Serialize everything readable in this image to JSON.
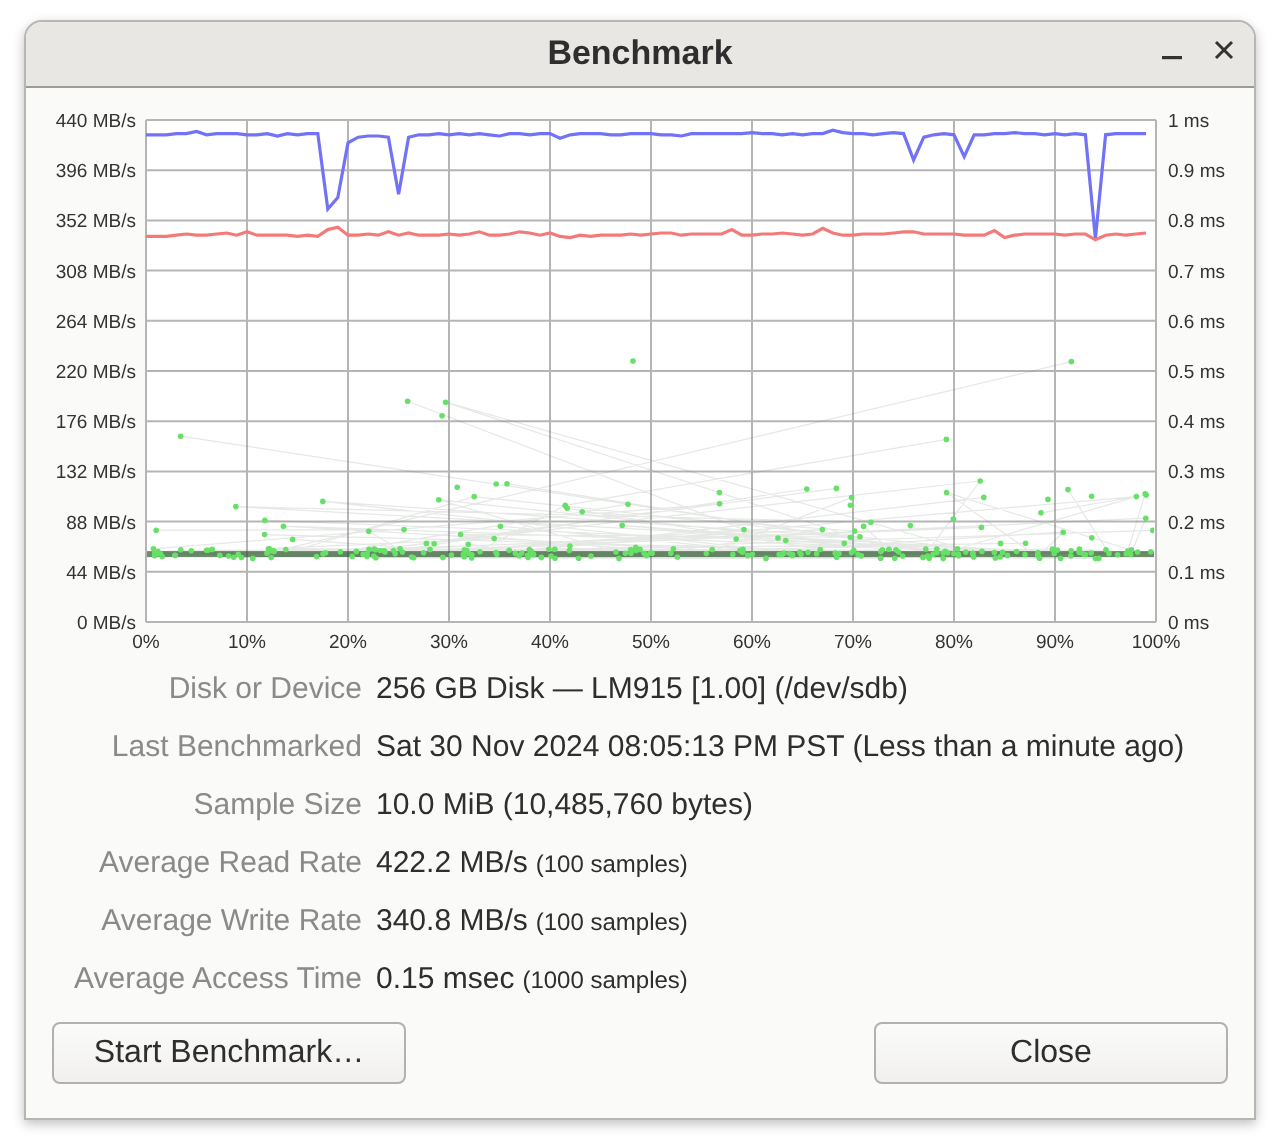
{
  "window": {
    "title": "Benchmark"
  },
  "chart": {
    "chart_data": {
      "type": "line",
      "x": [
        0,
        1,
        2,
        3,
        4,
        5,
        6,
        7,
        8,
        9,
        10,
        11,
        12,
        13,
        14,
        15,
        16,
        17,
        18,
        19,
        20,
        21,
        22,
        23,
        24,
        25,
        26,
        27,
        28,
        29,
        30,
        31,
        32,
        33,
        34,
        35,
        36,
        37,
        38,
        39,
        40,
        41,
        42,
        43,
        44,
        45,
        46,
        47,
        48,
        49,
        50,
        51,
        52,
        53,
        54,
        55,
        56,
        57,
        58,
        59,
        60,
        61,
        62,
        63,
        64,
        65,
        66,
        67,
        68,
        69,
        70,
        71,
        72,
        73,
        74,
        75,
        76,
        77,
        78,
        79,
        80,
        81,
        82,
        83,
        84,
        85,
        86,
        87,
        88,
        89,
        90,
        91,
        92,
        93,
        94,
        95,
        96,
        97,
        98,
        99
      ],
      "series": [
        {
          "color": "#7272f8",
          "values": [
            427,
            427,
            427,
            428,
            428,
            430,
            427,
            428,
            428,
            428,
            427,
            427,
            428,
            426,
            428,
            427,
            428,
            428,
            362,
            372,
            420,
            425,
            426,
            426,
            425,
            375,
            425,
            427,
            427,
            428,
            427,
            428,
            427,
            428,
            427,
            426,
            428,
            428,
            427,
            428,
            428,
            424,
            427,
            428,
            428,
            428,
            427,
            427,
            428,
            428,
            428,
            427,
            427,
            426,
            428,
            428,
            428,
            428,
            428,
            428,
            429,
            428,
            428,
            427,
            428,
            427,
            428,
            428,
            431,
            429,
            428,
            428,
            427,
            428,
            429,
            428,
            405,
            425,
            427,
            428,
            427,
            408,
            427,
            427,
            428,
            428,
            429,
            428,
            428,
            427,
            428,
            427,
            428,
            427,
            336,
            427,
            428,
            428,
            428,
            428
          ]
        },
        {
          "color": "#f47a7a",
          "values": [
            338,
            338,
            338,
            339,
            340,
            339,
            339,
            340,
            341,
            339,
            342,
            339,
            339,
            339,
            339,
            338,
            339,
            338,
            344,
            346,
            339,
            339,
            340,
            339,
            342,
            339,
            341,
            339,
            339,
            339,
            340,
            339,
            340,
            342,
            339,
            339,
            340,
            342,
            341,
            339,
            341,
            338,
            337,
            339,
            338,
            339,
            339,
            339,
            340,
            339,
            340,
            341,
            341,
            339,
            340,
            340,
            340,
            340,
            344,
            339,
            339,
            340,
            340,
            341,
            340,
            339,
            340,
            345,
            341,
            339,
            339,
            340,
            340,
            340,
            341,
            342,
            342,
            340,
            340,
            340,
            340,
            339,
            339,
            339,
            343,
            337,
            339,
            340,
            340,
            340,
            340,
            339,
            340,
            340,
            335,
            339,
            340,
            339,
            340,
            341
          ]
        }
      ],
      "grid": true,
      "xlim": [
        0,
        100
      ],
      "ylim": [
        0,
        440
      ],
      "xticks": [
        {
          "value": 0,
          "label": "0%"
        },
        {
          "value": 10,
          "label": "10%"
        },
        {
          "value": 20,
          "label": "20%"
        },
        {
          "value": 30,
          "label": "30%"
        },
        {
          "value": 40,
          "label": "40%"
        },
        {
          "value": 50,
          "label": "50%"
        },
        {
          "value": 60,
          "label": "60%"
        },
        {
          "value": 70,
          "label": "70%"
        },
        {
          "value": 80,
          "label": "80%"
        },
        {
          "value": 90,
          "label": "90%"
        },
        {
          "value": 100,
          "label": "100%"
        }
      ],
      "yticks": [
        {
          "value": 0,
          "label": "0 MB/s"
        },
        {
          "value": 44,
          "label": "44 MB/s"
        },
        {
          "value": 88,
          "label": "88 MB/s"
        },
        {
          "value": 132,
          "label": "132 MB/s"
        },
        {
          "value": 176,
          "label": "176 MB/s"
        },
        {
          "value": 220,
          "label": "220 MB/s"
        },
        {
          "value": 264,
          "label": "264 MB/s"
        },
        {
          "value": 308,
          "label": "308 MB/s"
        },
        {
          "value": 352,
          "label": "352 MB/s"
        },
        {
          "value": 396,
          "label": "396 MB/s"
        },
        {
          "value": 440,
          "label": "440 MB/s"
        }
      ]
    },
    "access_time_ticks": [
      "1 ms",
      "0.9 ms",
      "0.8 ms",
      "0.7 ms",
      "0.6 ms",
      "0.5 ms",
      "0.4 ms",
      "0.3 ms",
      "0.2 ms",
      "0.1 ms",
      "0 ms"
    ]
  },
  "details": [
    {
      "label": "Disk or Device",
      "value": "256 GB Disk — LM915 [1.00] (/dev/sdb)"
    },
    {
      "label": "Last Benchmarked",
      "value": "Sat 30 Nov 2024 08:05:13 PM PST (Less than a minute ago)"
    },
    {
      "label": "Sample Size",
      "value": "10.0 MiB (10,485,760 bytes)"
    },
    {
      "label": "Average Read Rate",
      "value": "422.2 MB/s",
      "note": "(100 samples)"
    },
    {
      "label": "Average Write Rate",
      "value": "340.8 MB/s",
      "note": "(100 samples)"
    },
    {
      "label": "Average Access Time",
      "value": "0.15 msec",
      "note": "(1000 samples)"
    }
  ],
  "buttons": [
    "Start Benchmark…",
    "Close"
  ]
}
